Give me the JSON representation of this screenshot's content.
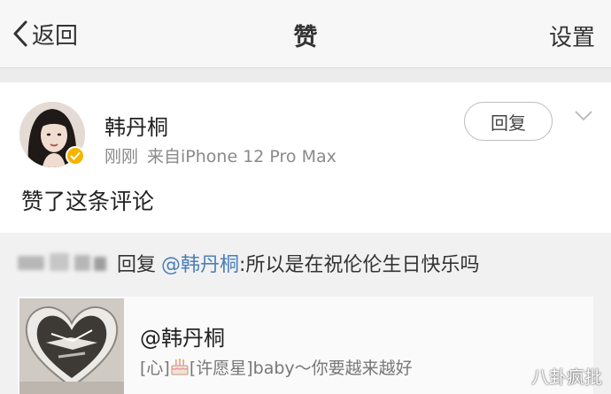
{
  "navbar": {
    "back_label": "返回",
    "title": "赞",
    "settings_label": "设置"
  },
  "notification": {
    "username": "韩丹桐",
    "time": "刚刚",
    "source": "来自iPhone 12 Pro Max",
    "reply_button": "回复",
    "action_text": "赞了这条评论"
  },
  "quoted": {
    "reply_prefix": "回复",
    "mention": "@韩丹桐",
    "comment": ":所以是在祝伦伦生日快乐吗",
    "original_user": "@韩丹桐",
    "original_text_a": "[心]",
    "original_text_b": "[许愿星]baby～你要越来越好",
    "original_emoji": "cake-icon"
  },
  "watermark": "八卦疯批",
  "colors": {
    "link": "#4a7fb8",
    "badge": "#f5b400",
    "muted": "#8a8a8a"
  }
}
